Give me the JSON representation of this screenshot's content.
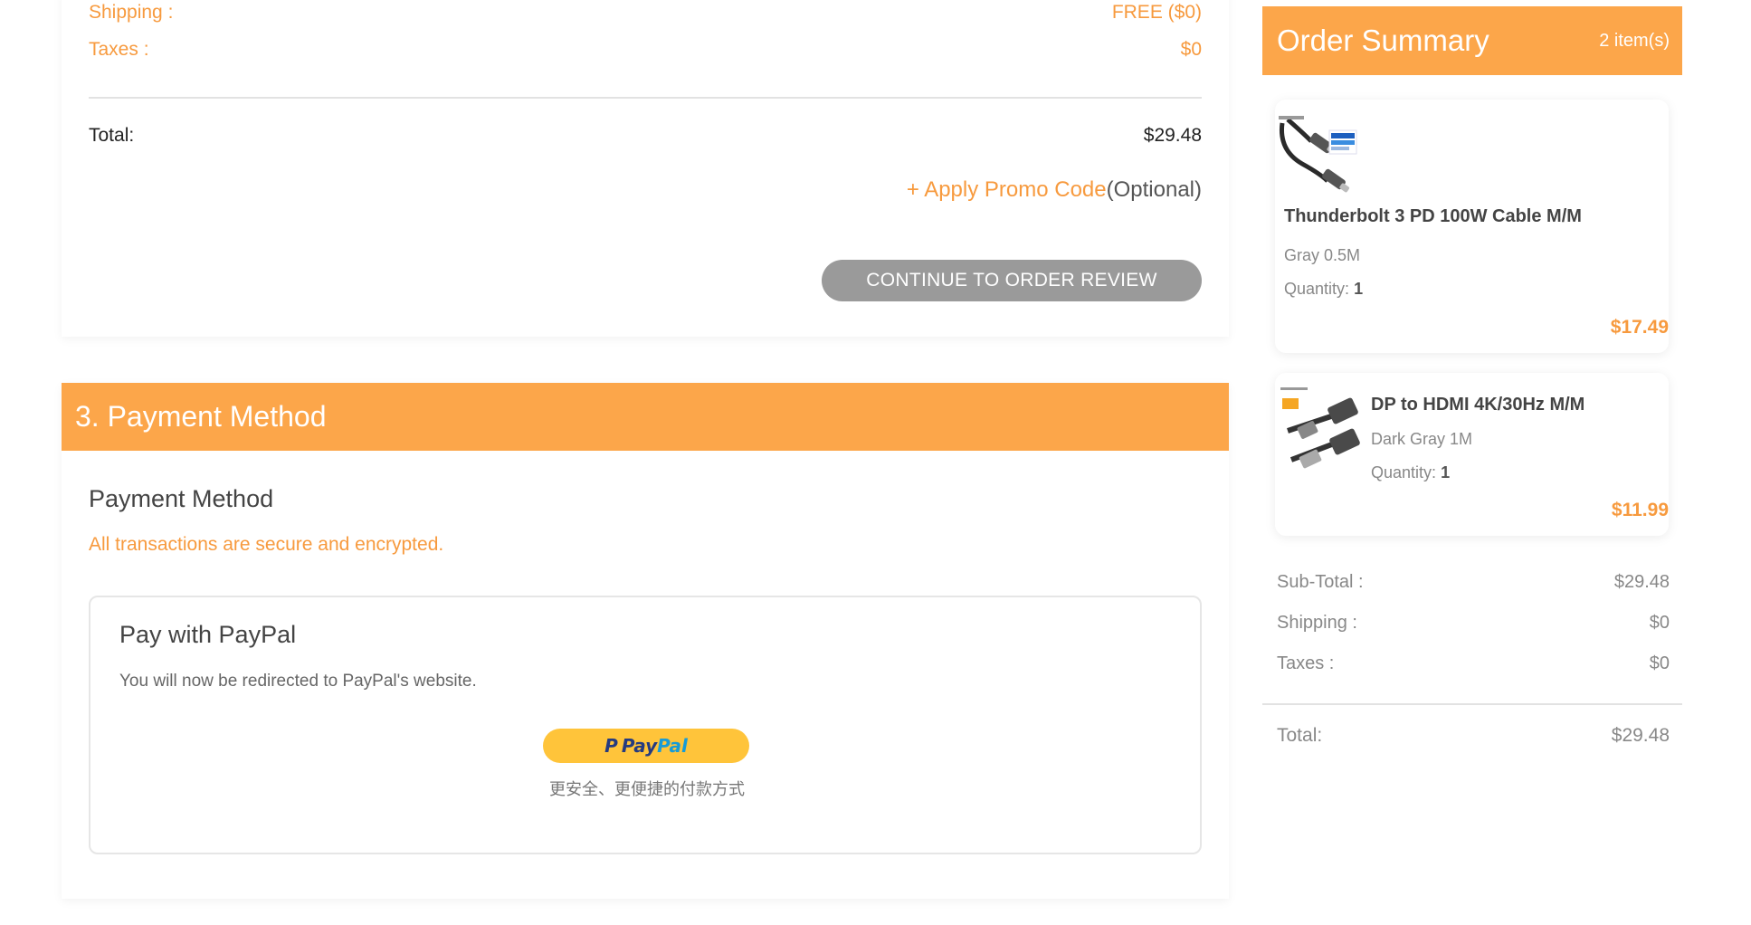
{
  "summary_top": {
    "shipping_label": "Shipping :",
    "shipping_value": "FREE ($0)",
    "taxes_label": "Taxes :",
    "taxes_value": "$0",
    "total_label": "Total:",
    "total_value": "$29.48",
    "promo_link": "+ Apply Promo Code",
    "promo_optional": "(Optional)",
    "continue_button": "CONTINUE TO ORDER REVIEW"
  },
  "payment": {
    "section_title": "3. Payment Method",
    "method_title": "Payment Method",
    "secure_note": "All transactions are secure and encrypted.",
    "paypal_title": "Pay with PayPal",
    "paypal_desc": "You will now be redirected to PayPal's website.",
    "paypal_button_mark": "P",
    "paypal_button_pay": "Pay",
    "paypal_button_pal": "Pal",
    "paypal_tagline": "更安全、更便捷的付款方式"
  },
  "order_summary": {
    "title": "Order Summary",
    "count": "2 item(s)",
    "items": [
      {
        "name": "Thunderbolt 3 PD 100W Cable M/M",
        "variant": "Gray 0.5M",
        "quantity_label": "Quantity:",
        "quantity": "1",
        "price": "$17.49",
        "image_icon": "usb-c-cable-icon"
      },
      {
        "name": "DP to HDMI 4K/30Hz M/M",
        "variant": "Dark Gray 1M",
        "quantity_label": "Quantity:",
        "quantity": "1",
        "price": "$11.99",
        "image_icon": "dp-hdmi-cable-icon"
      }
    ],
    "subtotal_label": "Sub-Total :",
    "subtotal_value": "$29.48",
    "shipping_label": "Shipping :",
    "shipping_value": "$0",
    "taxes_label": "Taxes :",
    "taxes_value": "$0",
    "total_label": "Total:",
    "total_value": "$29.48"
  },
  "colors": {
    "accent": "#fca64a",
    "accent_text": "#f79a3e",
    "button_gray": "#9a9a9a",
    "paypal_yellow": "#ffc43a"
  }
}
